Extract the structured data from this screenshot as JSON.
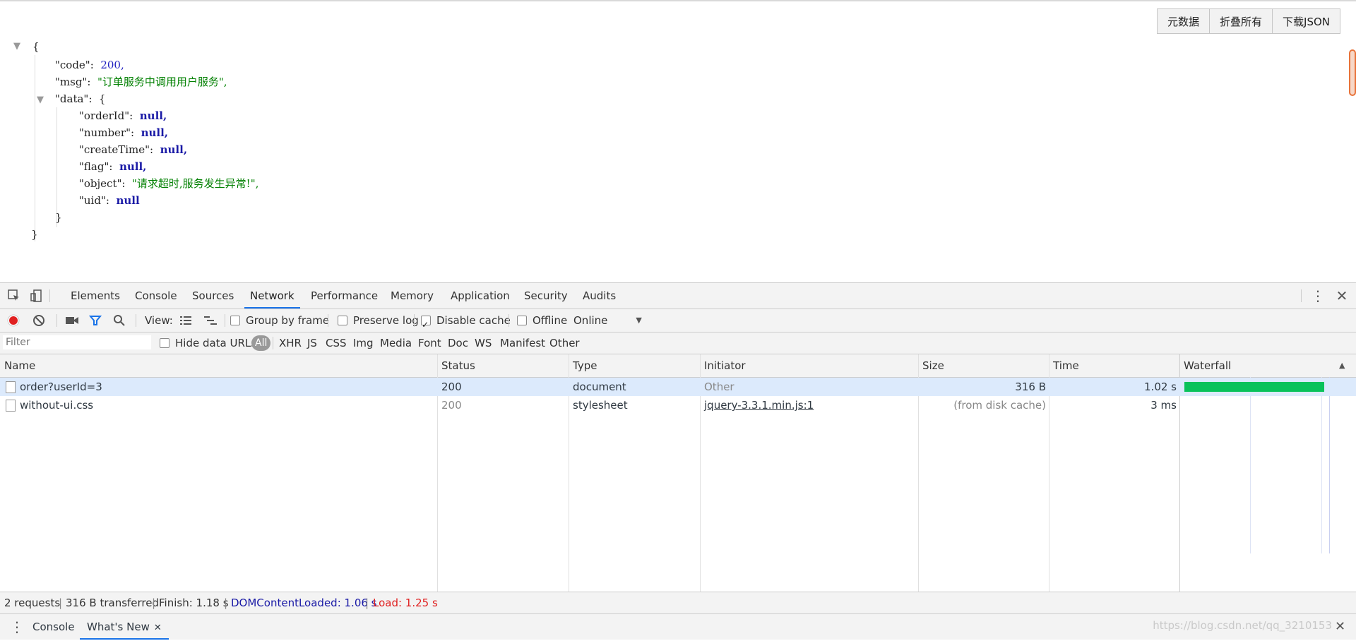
{
  "json_viewer": {
    "buttons": [
      "元数据",
      "折叠所有",
      "下载JSON"
    ],
    "open_brace": "{",
    "close_brace": "}",
    "code_key": "\"code\":",
    "code_val": "200,",
    "msg_key": "\"msg\":",
    "msg_val": "\"订单服务中调用用户服务\",",
    "data_key": "\"data\":",
    "data_open": "{",
    "orderId_key": "\"orderId\":",
    "number_key": "\"number\":",
    "createTime_key": "\"createTime\":",
    "flag_key": "\"flag\":",
    "object_key": "\"object\":",
    "object_val": "\"请求超时,服务发生异常!\",",
    "uid_key": "\"uid\":",
    "null_comma": "null,",
    "null_plain": "null",
    "data_close": "}"
  },
  "devtools": {
    "tabs": [
      "Elements",
      "Console",
      "Sources",
      "Network",
      "Performance",
      "Memory",
      "Application",
      "Security",
      "Audits"
    ],
    "active_tab": "Network",
    "toolbar": {
      "view_label": "View:",
      "group_by_frame": "Group by frame",
      "preserve_log": "Preserve log",
      "disable_cache": "Disable cache",
      "offline": "Offline",
      "throttle": "Online"
    },
    "filter": {
      "placeholder": "Filter",
      "hide_data_urls": "Hide data URLs",
      "types": [
        "All",
        "XHR",
        "JS",
        "CSS",
        "Img",
        "Media",
        "Font",
        "Doc",
        "WS",
        "Manifest",
        "Other"
      ]
    },
    "columns": [
      "Name",
      "Status",
      "Type",
      "Initiator",
      "Size",
      "Time",
      "Waterfall"
    ],
    "rows": [
      {
        "name": "order?userId=3",
        "status": "200",
        "type": "document",
        "initiator": "Other",
        "size": "316 B",
        "time": "1.02 s"
      },
      {
        "name": "without-ui.css",
        "status": "200",
        "type": "stylesheet",
        "initiator": "jquery-3.3.1.min.js:1",
        "size": "(from disk cache)",
        "time": "3 ms"
      }
    ],
    "status": {
      "requests": "2 requests",
      "transferred": "316 B transferred",
      "finish": "Finish: 1.18 s",
      "dom_loaded": "DOMContentLoaded: 1.06 s",
      "load": "Load: 1.25 s"
    },
    "drawer": {
      "tabs": [
        "Console",
        "What's New"
      ],
      "active": "What's New"
    },
    "watermark": "https://blog.csdn.net/qq_3210153"
  },
  "colors": {
    "accent": "#1a73e8",
    "record": "#e02020",
    "dom_loaded": "#1a1aa6",
    "load": "#e02020",
    "waterfall_bar": "#09c25a"
  }
}
